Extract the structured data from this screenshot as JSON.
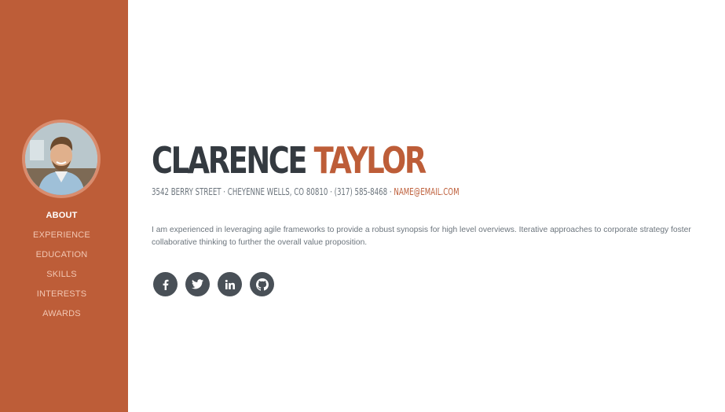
{
  "sidebar": {
    "bg_color": "#bd5d38",
    "avatar_icon": "profile-photo",
    "nav": [
      {
        "label": "About",
        "active": true
      },
      {
        "label": "Experience",
        "active": false
      },
      {
        "label": "Education",
        "active": false
      },
      {
        "label": "Skills",
        "active": false
      },
      {
        "label": "Interests",
        "active": false
      },
      {
        "label": "Awards",
        "active": false
      }
    ]
  },
  "profile": {
    "first_name": "Clarence",
    "last_name": "Taylor",
    "address": "3542 Berry Street · Cheyenne Wells, CO 80810 · (317) 585-8468 ·",
    "email": "name@email.com",
    "intro": "I am experienced in leveraging agile frameworks to provide a robust synopsis for high level overviews. Iterative approaches to corporate strategy foster collaborative thinking to further the overall value proposition."
  },
  "social": {
    "icons": [
      "facebook-icon",
      "twitter-icon",
      "linkedin-icon",
      "github-icon"
    ],
    "color": "#495057"
  }
}
